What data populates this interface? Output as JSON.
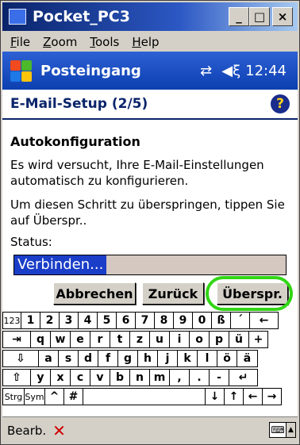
{
  "window": {
    "title": "Pocket_PC3",
    "min": "_",
    "max": "□",
    "close": "×"
  },
  "menu": {
    "items": [
      "File",
      "Zoom",
      "Tools",
      "Help"
    ]
  },
  "nav": {
    "title": "Posteingang",
    "connectivity": "⇄",
    "volume": "◀ξ",
    "time": "12:44"
  },
  "app": {
    "header": "E-Mail-Setup (2/5)",
    "help": "?"
  },
  "content": {
    "heading": "Autokonfiguration",
    "para1": "Es wird versucht, Ihre E-Mail-Einstellungen automatisch zu konfigurieren.",
    "para2": "Um diesen Schritt zu überspringen, tippen Sie auf Überspr..",
    "status_label": "Status:",
    "status_value": "Verbinden..."
  },
  "buttons": {
    "cancel": "Abbrechen",
    "back": "Zurück",
    "skip": "Überspr."
  },
  "keyboard": {
    "row1": [
      "123",
      "1",
      "2",
      "3",
      "4",
      "5",
      "6",
      "7",
      "8",
      "9",
      "0",
      "ß",
      "´",
      "←"
    ],
    "row2": [
      "⇥",
      "q",
      "w",
      "e",
      "r",
      "t",
      "z",
      "u",
      "i",
      "o",
      "p",
      "ü",
      "+"
    ],
    "row3": [
      "⇩",
      "a",
      "s",
      "d",
      "f",
      "g",
      "h",
      "j",
      "k",
      "l",
      "ö",
      "ä"
    ],
    "row4": [
      "⇧",
      "y",
      "x",
      "c",
      "v",
      "b",
      "n",
      "m",
      ",",
      ".",
      "-",
      "↵"
    ],
    "row5": [
      "Strg",
      "Sym",
      "^",
      "#",
      "",
      "↓",
      "↑",
      "←",
      "→"
    ]
  },
  "bottom": {
    "label": "Bearb.",
    "cancel_icon": "✕",
    "keyboard_icon": "⌨",
    "arrow": "▲"
  }
}
